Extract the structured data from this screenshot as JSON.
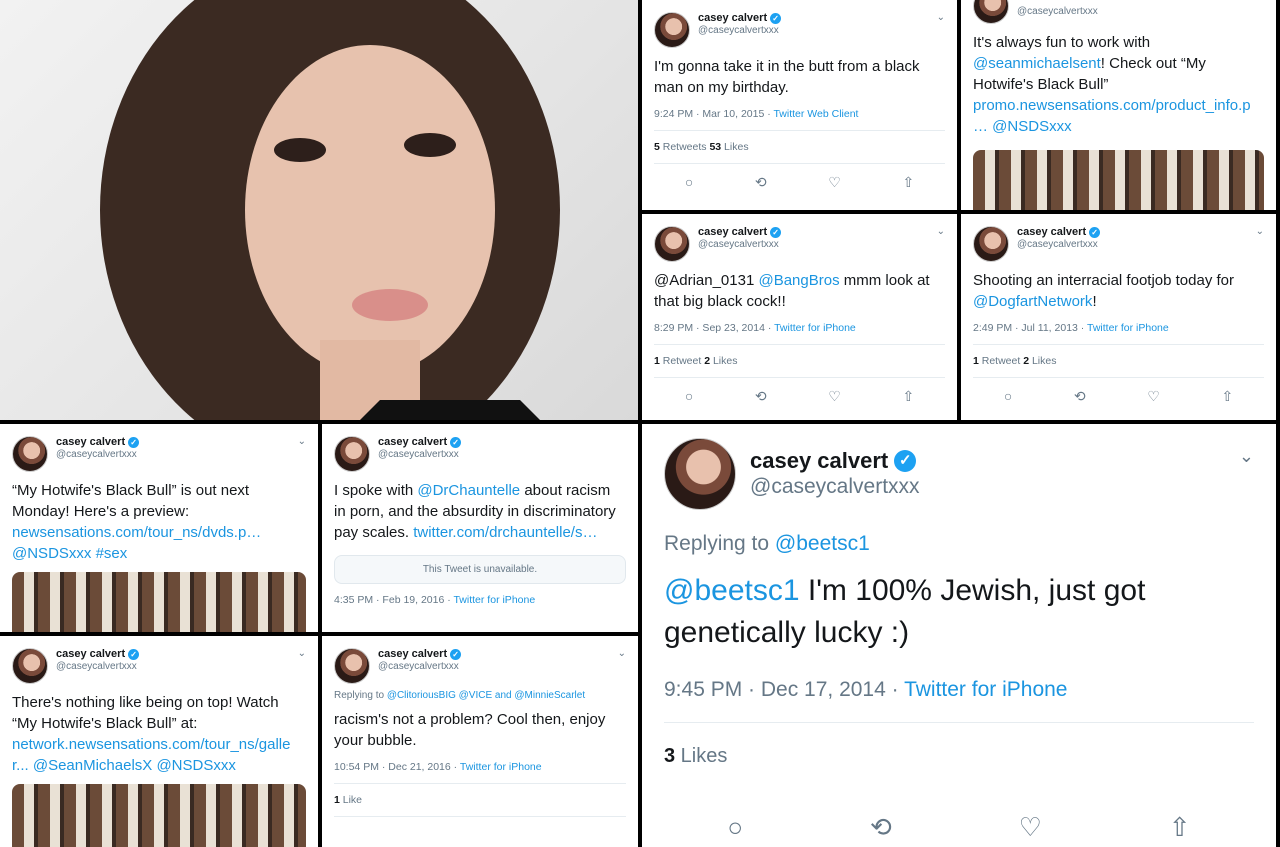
{
  "author": {
    "name": "casey calvert",
    "handle": "@caseycalvertxxx",
    "verified_icon": "verified-badge-icon",
    "verified_glyph": "✓"
  },
  "icons": {
    "chevron": "⌄",
    "reply": "○",
    "retweet": "⟲",
    "like": "♡",
    "share": "⇧"
  },
  "colors": {
    "link": "#1b95e0",
    "muted": "#657786"
  },
  "t1": {
    "body": "I'm gonna take it in the butt from a black man on my birthday.",
    "time": "9:24 PM · Mar 10, 2015 · ",
    "source": "Twitter Web Client",
    "stat1_num": "5",
    "stat1_label": " Retweets ",
    "stat2_num": "53",
    "stat2_label": " Likes"
  },
  "t2": {
    "text_a": "It's always fun to work with ",
    "link_a": "@seanmichaelsent",
    "text_b": "! Check out “My Hotwife's Black Bull” ",
    "link_b": "promo.newsensations.com/product_info.p … @NSDSxxx"
  },
  "t3": {
    "link_a": "@Adrian_0131 ",
    "link_b": "@BangBros",
    "text_b": " mmm look at that big black cock!!",
    "time": "8:29 PM · Sep 23, 2014 · ",
    "source": "Twitter for iPhone",
    "stat1_num": "1",
    "stat1_label": " Retweet ",
    "stat2_num": "2",
    "stat2_label": " Likes"
  },
  "t4": {
    "text_a": "Shooting an interracial footjob today for ",
    "link_a": "@DogfartNetwork",
    "text_b": "!",
    "time": "2:49 PM · Jul 11, 2013 · ",
    "source": "Twitter for iPhone",
    "stat1_num": "1",
    "stat1_label": " Retweet ",
    "stat2_num": "2",
    "stat2_label": " Likes"
  },
  "t5": {
    "text_a": "“My Hotwife's Black Bull” is out next Monday! Here's a preview: ",
    "link_a": "newsensations.com/tour_ns/dvds.p… @NSDSxxx #sex"
  },
  "t6": {
    "text_a": "I spoke with ",
    "link_a": "@DrChauntelle",
    "text_b": " about racism in porn, and the absurdity in discriminatory pay scales. ",
    "link_b": "twitter.com/drchauntelle/s…",
    "unavailable": "This Tweet is unavailable.",
    "time": "4:35 PM · Feb 19, 2016 · ",
    "source": "Twitter for iPhone"
  },
  "t7": {
    "text_a": "There's nothing like being on top! Watch “My Hotwife's Black Bull” at: ",
    "link_a": "network.newsensations.com/tour_ns/galle r... @SeanMichaelsX @NSDSxxx"
  },
  "t8": {
    "reply_prefix": "Replying to ",
    "reply_to": "@ClitoriousBIG @VICE and @MinnieScarlet",
    "body": "racism's not a problem? Cool then, enjoy your bubble.",
    "time": "10:54 PM · Dec 21, 2016 · ",
    "source": "Twitter for iPhone",
    "stat1_num": "1",
    "stat1_label": " Like"
  },
  "t9": {
    "reply_prefix": "Replying to ",
    "reply_to": "@beetsc1",
    "link_a": "@beetsc1",
    "text_a": " I'm 100% Jewish, just got genetically lucky :)",
    "time": "9:45 PM · Dec 17, 2014 · ",
    "source": "Twitter for iPhone",
    "stat1_num": "3",
    "stat1_label": " Likes"
  }
}
